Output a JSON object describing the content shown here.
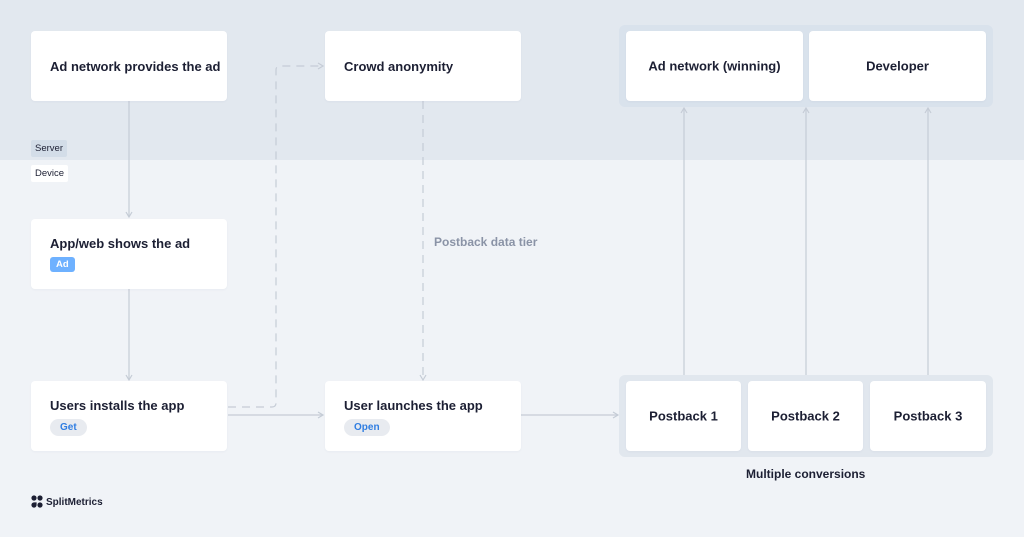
{
  "zones": {
    "server_label": "Server",
    "device_label": "Device"
  },
  "nodes": {
    "ad_network": {
      "title": "Ad network provides the ad"
    },
    "app_web": {
      "title": "App/web shows the ad",
      "badge": "Ad"
    },
    "user_installs": {
      "title": "Users installs the app",
      "button": "Get"
    },
    "crowd_anonymity": {
      "title": "Crowd anonymity"
    },
    "user_launches": {
      "title": "User launches the app",
      "button": "Open"
    },
    "receivers": [
      {
        "title": "Ad network (winning)"
      },
      {
        "title": "Developer"
      }
    ],
    "postbacks": [
      {
        "title": "Postback 1"
      },
      {
        "title": "Postback 2"
      },
      {
        "title": "Postback 3"
      }
    ]
  },
  "annotations": {
    "postback_tier": "Postback data tier",
    "multiple_conversions": "Multiple conversions"
  },
  "branding": {
    "logo_text": "SplitMetrics"
  },
  "colors": {
    "server_bg": "#e2e8ef",
    "device_bg": "#f0f3f7",
    "accent_blue": "#2f7de1",
    "ad_badge": "#6eb1ff",
    "connector": "#c5ccd6"
  }
}
